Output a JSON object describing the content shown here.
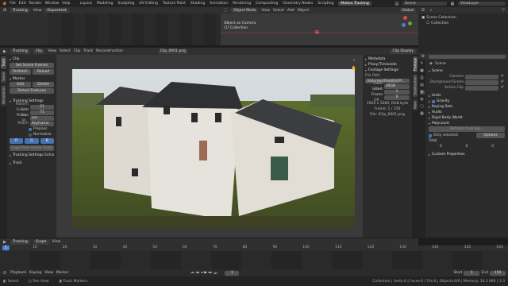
{
  "topbar": {
    "menus": [
      "File",
      "Edit",
      "Render",
      "Window",
      "Help"
    ],
    "workspaces": [
      "Layout",
      "Modeling",
      "Sculpting",
      "UV Editing",
      "Texture Paint",
      "Shading",
      "Animation",
      "Rendering",
      "Compositing",
      "Geometry Nodes",
      "Scripting",
      "Motion Tracking"
    ],
    "active_workspace": "Motion Tracking",
    "scene": "Scene",
    "view_layer": "ViewLayer"
  },
  "dopesheet_top": {
    "mode": "Tracking",
    "view": "View",
    "filter": "Dopesheet"
  },
  "mini_viewport": {
    "mode": "Object Mode",
    "menus": [
      "View",
      "Select",
      "Add",
      "Object"
    ],
    "transform": "Global",
    "overlay_line1": "Object as Camera",
    "overlay_line2": "(1) Collection",
    "average_error": "Average Error: 0.00"
  },
  "outliner": {
    "title": "Scene Collection",
    "item": "Collection"
  },
  "clip_editor": {
    "mode": "Tracking",
    "clip_menu": "Clip",
    "menus": [
      "View",
      "Select",
      "Clip",
      "Track",
      "Reconstruction"
    ],
    "clip_name": "Clip_0001.png",
    "display": "Clip Display"
  },
  "tool_panel": {
    "clip_section": "Clip",
    "set_scene_frames": "Set Scene Frames",
    "prefetch": "Prefetch",
    "reload": "Reload",
    "marker_section": "Marker",
    "add": "Add",
    "delete": "Delete",
    "detect_features": "Detect Features",
    "tracking_settings": "Tracking Settings",
    "pattern_size_label": "Pattern Size",
    "pattern_size": "21",
    "search_size_label": "Search Size",
    "search_size": "71",
    "motion_label": "Motion M...",
    "motion_value": "Loc",
    "match_label": "Match",
    "match_value": "Keyframe",
    "prepass": "Prepass",
    "normalize": "Normalize",
    "channels": [
      "R",
      "G",
      "B"
    ],
    "copy_settings": "Copy from Active Track",
    "tracking_extra": "Tracking Settings Extra",
    "track_section": "Track",
    "vtabs": [
      "Track",
      "Solve",
      "Annotation"
    ]
  },
  "right_clip_panel": {
    "metadata": "Metadata",
    "proxy": "Proxy/Timecode",
    "footage_settings": "Footage Settings",
    "file_path_label": "File Path",
    "file_path": "/Volumes/Raid0/LIP/...",
    "color_space_label": "Color Space",
    "color_space": "sRGB",
    "start_frame_label": "Start Frame",
    "start_frame": "1",
    "frame_offset_label": "Frame Off...",
    "frame_offset": "0",
    "info1": "1920 x 1080, RGB byte",
    "info2": "Frame: 1 / 150",
    "info3": "File: IClip_0001.png",
    "vtabs": [
      "Footage",
      "Stabilization",
      "View"
    ]
  },
  "properties": {
    "scene_title": "Scene",
    "scene_section": "Scene",
    "camera_label": "Camera",
    "camera_value": "",
    "bg_scene_label": "Background Scene",
    "active_clip_label": "Active Clip",
    "active_clip_value": "",
    "units": "Units",
    "gravity": "Gravity",
    "keying_sets": "Keying Sets",
    "audio": "Audio",
    "rigid_body": "Rigid Body World",
    "rbw_note": "Refresh Cam Sig...",
    "only_selected": "Only selected",
    "options": "Options",
    "total_label": "Total",
    "total_cols": [
      "0",
      "0",
      "0"
    ],
    "custom_props": "Custom Properties"
  },
  "graph": {
    "mode": "Tracking",
    "graph": "Graph",
    "view": "View"
  },
  "timeline": {
    "header": [
      "Playback",
      "Keying",
      "View",
      "Marker"
    ],
    "current_frame": "1",
    "start_label": "Start",
    "start": "1",
    "end_label": "End",
    "end": "150",
    "ticks": [
      "0",
      "10",
      "20",
      "30",
      "40",
      "50",
      "60",
      "70",
      "80",
      "90",
      "100",
      "110",
      "120",
      "130",
      "140",
      "150",
      "160"
    ]
  },
  "statusbar": {
    "left": [
      "Select",
      "Pan View",
      "Track Markers"
    ],
    "right": "Collection | Verts:0 | Faces:0 | Tris:0 | Objects:0/0 | Memory: 34.2 MiB | 3.3"
  },
  "colors": {
    "accent": "#4772b3",
    "playhead": "#4a7fd4",
    "bg": "#1d1d1d",
    "panel": "#2b2b2b"
  }
}
